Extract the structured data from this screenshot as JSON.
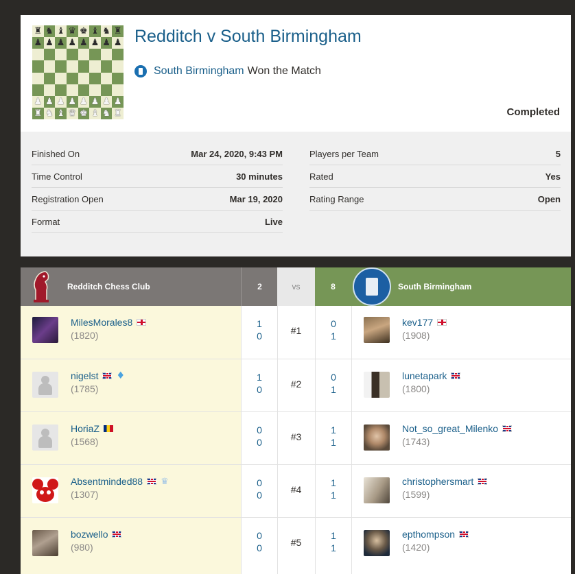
{
  "match": {
    "title": "Redditch v South Birmingham",
    "winner_name": "South Birmingham",
    "winner_suffix": "Won the Match",
    "status": "Completed"
  },
  "details": {
    "left": [
      {
        "label": "Finished On",
        "value": "Mar 24, 2020, 9:43 PM"
      },
      {
        "label": "Time Control",
        "value": "30 minutes"
      },
      {
        "label": "Registration Open",
        "value": "Mar 19, 2020"
      },
      {
        "label": "Format",
        "value": "Live"
      }
    ],
    "right": [
      {
        "label": "Players per Team",
        "value": "5"
      },
      {
        "label": "Rated",
        "value": "Yes"
      },
      {
        "label": "Rating Range",
        "value": "Open"
      }
    ]
  },
  "teams": {
    "left": {
      "name": "Redditch Chess Club",
      "score": "2"
    },
    "vs": "vs",
    "right": {
      "name": "South Birmingham",
      "score": "8"
    }
  },
  "boards": [
    {
      "board": "#1",
      "left": {
        "name": "MilesMorales8",
        "rating": "(1820)",
        "flag": "england",
        "scores": [
          "1",
          "0"
        ]
      },
      "right": {
        "name": "kev177",
        "rating": "(1908)",
        "flag": "england",
        "scores": [
          "0",
          "1"
        ]
      }
    },
    {
      "board": "#2",
      "left": {
        "name": "nigelst",
        "rating": "(1785)",
        "flag": "united-kingdom",
        "badge": "diamond",
        "scores": [
          "1",
          "0"
        ]
      },
      "right": {
        "name": "lunetapark",
        "rating": "(1800)",
        "flag": "united-kingdom",
        "scores": [
          "0",
          "1"
        ]
      }
    },
    {
      "board": "#3",
      "left": {
        "name": "HoriaZ",
        "rating": "(1568)",
        "flag": "romania",
        "scores": [
          "0",
          "0"
        ]
      },
      "right": {
        "name": "Not_so_great_Milenko",
        "rating": "(1743)",
        "flag": "united-kingdom",
        "scores": [
          "1",
          "1"
        ]
      }
    },
    {
      "board": "#4",
      "left": {
        "name": "Absentminded88",
        "rating": "(1307)",
        "flag": "united-kingdom",
        "badge": "crown",
        "scores": [
          "0",
          "0"
        ]
      },
      "right": {
        "name": "christophersmart",
        "rating": "(1599)",
        "flag": "united-kingdom",
        "scores": [
          "1",
          "1"
        ]
      }
    },
    {
      "board": "#5",
      "left": {
        "name": "bozwello",
        "rating": "(980)",
        "flag": "united-kingdom",
        "scores": [
          "0",
          "0"
        ]
      },
      "right": {
        "name": "epthompson",
        "rating": "(1420)",
        "flag": "united-kingdom",
        "scores": [
          "1",
          "1"
        ]
      }
    }
  ],
  "colors": {
    "link": "#1a5f8a",
    "header_grey": "#7b7775",
    "header_green": "#769656",
    "left_column_bg": "#fbf8dc"
  },
  "icons": {
    "board_thumbnail": "chessboard-icon",
    "winner": "club-shield-icon",
    "diamond": "diamond-membership-icon",
    "crown": "crown-badge-icon"
  }
}
